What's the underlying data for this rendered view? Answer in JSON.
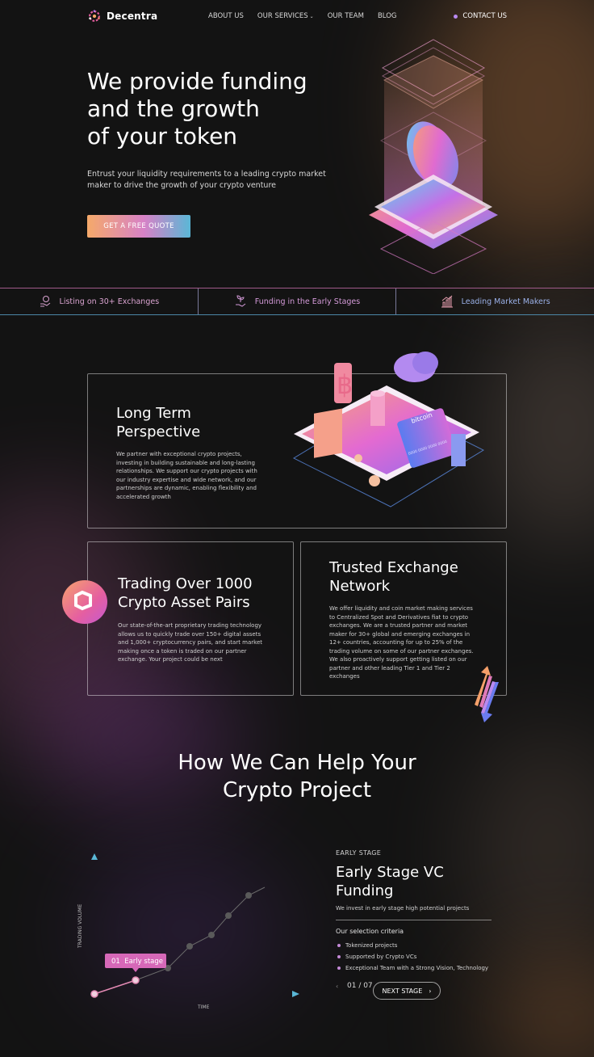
{
  "brand": {
    "name": "Decentra"
  },
  "nav": {
    "items": [
      "ABOUT US",
      "OUR SERVICES",
      "OUR TEAM",
      "BLOG"
    ],
    "contact": "CONTACT US"
  },
  "hero": {
    "title_lines": [
      "We provide funding",
      "and the growth",
      "of your token"
    ],
    "subtitle": "Entrust your liquidity requirements to a leading crypto market maker to drive the growth of your crypto venture",
    "cta": "GET A FREE QUOTE"
  },
  "stats": [
    {
      "icon": "coin-hand-icon",
      "label": "Listing on 30+ Exchanges"
    },
    {
      "icon": "seedling-hand-icon",
      "label": "Funding in the Early Stages"
    },
    {
      "icon": "bar-chart-icon",
      "label": "Leading Market Makers"
    }
  ],
  "cards": {
    "long_term": {
      "title": "Long Term Perspective",
      "text": "We partner with exceptional crypto projects, investing in building sustainable and long-lasting relationships. We support our crypto projects with our industry expertise and wide network, and our partnerships are dynamic, enabling flexibility and accelerated growth",
      "card_text": "bitcoin",
      "card_number": "0000 0000 0000 0000"
    },
    "trading": {
      "title": "Trading Over 1000 Crypto Asset Pairs",
      "text": "Our state-of-the-art proprietary trading technology allows us to quickly trade over 150+ digital assets and 1,000+ cryptocurrency pairs, and start market making once a token is traded on our partner exchange. Your project could be next"
    },
    "exchange": {
      "title": "Trusted Exchange Network",
      "text": "We offer liquidity and coin market making services to Centralized Spot and Derivatives fiat to crypto exchanges. We are a trusted partner and market maker for 30+ global and emerging exchanges in 12+ countries, accounting for up to 25% of the trading volume on some of our partner exchanges. We also proactively support getting listed on our partner and other leading Tier 1 and Tier 2 exchanges"
    }
  },
  "help": {
    "title_lines": [
      "How We Can Help Your",
      "Crypto Project"
    ],
    "chart": {
      "y_label": "TRADING VOLUME",
      "x_label": "TIME",
      "tooltip": "01  Early stage"
    },
    "stage": {
      "eyebrow": "EARLY STAGE",
      "title": "Early Stage VC Funding",
      "subtitle": "We invest in early stage high potential projects",
      "criteria_title": "Our selection criteria",
      "criteria": [
        "Tokenized projects",
        "Supported by Crypto VCs",
        "Exceptional Team with a Strong Vision, Technology"
      ],
      "pager": "01 / 07",
      "next": "NEXT STAGE"
    }
  },
  "colors": {
    "bg": "#131313",
    "accent_pink": "#d782c7",
    "accent_orange": "#f5a96a",
    "accent_blue": "#5ab7d6"
  }
}
